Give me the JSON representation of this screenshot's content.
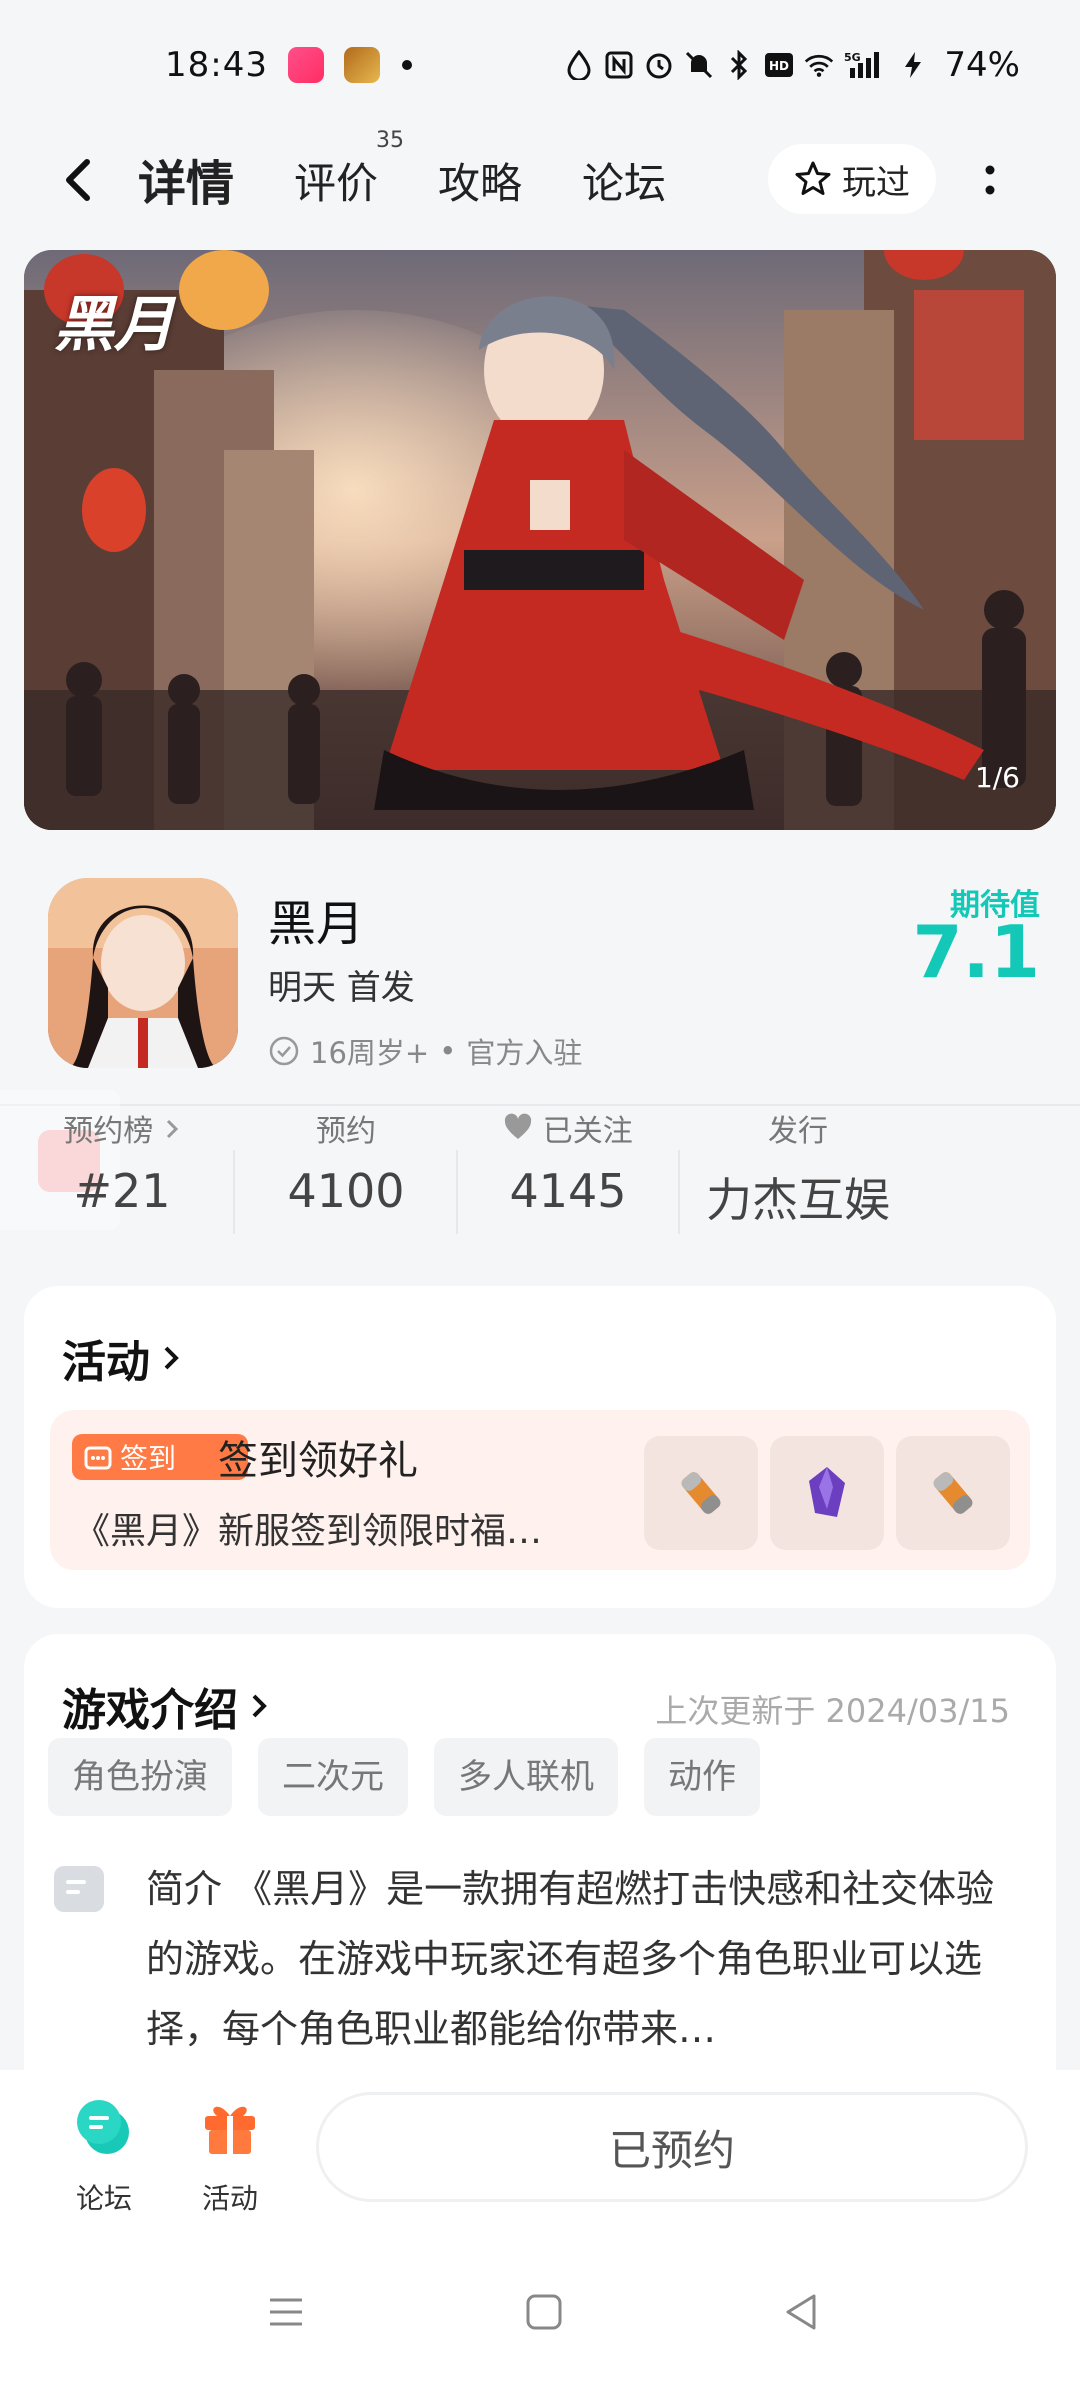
{
  "status_bar": {
    "time": "18:43",
    "battery": "74%",
    "network": "5G",
    "icons": [
      "app-notification-icon",
      "game-app-icon",
      "dot-icon",
      "water-drop-icon",
      "nfc-icon",
      "alarm-icon",
      "mute-icon",
      "bluetooth-icon",
      "hd-icon",
      "wifi-icon",
      "signal-icon",
      "charging-icon"
    ]
  },
  "nav": {
    "tabs": [
      {
        "label": "详情",
        "active": true
      },
      {
        "label": "评价",
        "badge": "35"
      },
      {
        "label": "攻略"
      },
      {
        "label": "论坛"
      }
    ],
    "played_label": "玩过"
  },
  "banner": {
    "counter": "1/6",
    "logo_text": "黑月"
  },
  "game": {
    "title": "黑月",
    "release": "明天 首发",
    "age_rating": "16周岁+",
    "official": "官方入驻",
    "meta_separator": "•",
    "expect_label": "期待值",
    "expect_value": "7.1"
  },
  "stats": [
    {
      "label": "预约榜",
      "value": "#21"
    },
    {
      "label": "预约",
      "value": "4100"
    },
    {
      "label": "已关注",
      "value": "4145"
    },
    {
      "label": "发行",
      "value": "力杰互娱"
    }
  ],
  "activity": {
    "title": "活动",
    "tag": "签到",
    "event_title": "签到领好礼",
    "event_desc": "《黑月》新服签到领限时福…",
    "rewards": [
      "pill-item-icon",
      "crystal-item-icon",
      "pill-item-icon"
    ]
  },
  "intro": {
    "title": "游戏介绍",
    "updated": "上次更新于 2024/03/15",
    "tags": [
      "角色扮演",
      "二次元",
      "多人联机",
      "动作"
    ],
    "text": "简介 《黑月》是一款拥有超燃打击快感和社交体验的游戏。在游戏中玩家还有超多个角色职业可以选择，每个角色职业都能给你带来…"
  },
  "bottom_bar": {
    "forum_label": "论坛",
    "activity_label": "活动",
    "reserved_label": "已预约"
  },
  "colors": {
    "accent": "#14c8b8",
    "checkin": "#ff7a45",
    "background": "#f4f6f8"
  }
}
